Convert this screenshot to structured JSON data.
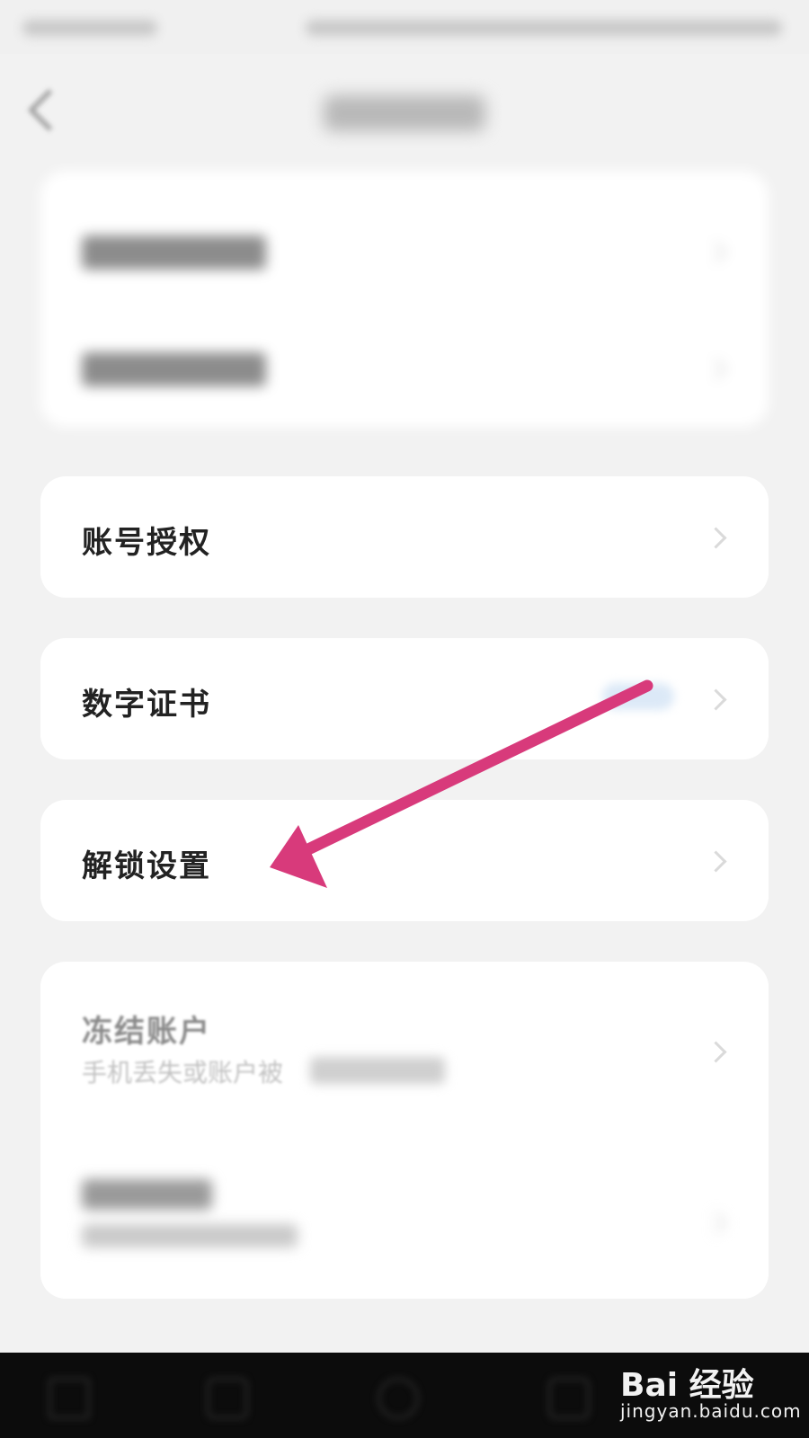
{
  "rows": {
    "account_auth": {
      "label": "账号授权"
    },
    "digital_cert": {
      "label": "数字证书"
    },
    "unlock_settings": {
      "label": "解锁设置"
    },
    "freeze_account": {
      "label": "冻结账户",
      "sub": "手机丢失或账户被"
    }
  },
  "colors": {
    "background": "#f2f2f2",
    "card": "#ffffff",
    "arrow": "#d83a7b",
    "nav_bar": "#0c0c0c"
  },
  "watermark": {
    "logo": "Bai 经验",
    "url": "jingyan.baidu.com"
  },
  "icons": [
    "back-icon",
    "chevron-right-icon",
    "annotation-arrow-icon",
    "baidu-paw-icon"
  ]
}
